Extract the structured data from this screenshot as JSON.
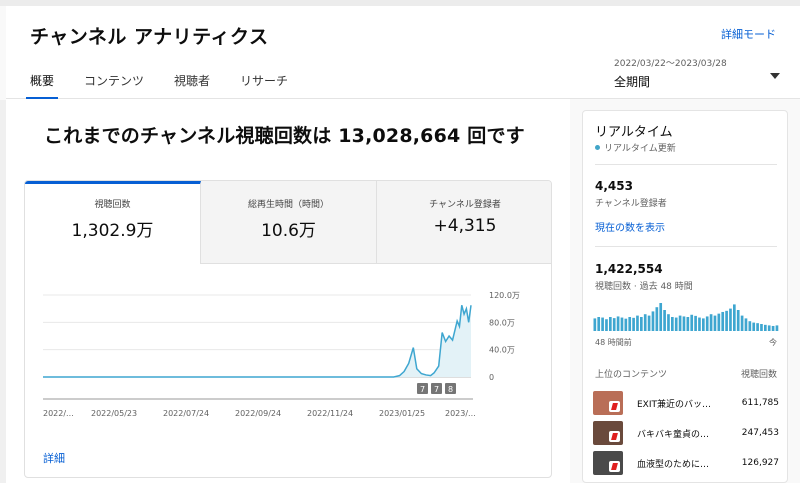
{
  "header": {
    "title": "チャンネル アナリティクス",
    "detail_mode": "詳細モード",
    "tabs": [
      "概要",
      "コンテンツ",
      "視聴者",
      "リサーチ"
    ],
    "period_range": "2022/03/22～2023/03/28",
    "period_value": "全期間"
  },
  "main": {
    "headline": "これまでのチャンネル視聴回数は 13,028,664 回です",
    "metrics": [
      {
        "label": "視聴回数",
        "value": "1,302.9万"
      },
      {
        "label": "総再生時間（時間）",
        "value": "10.6万"
      },
      {
        "label": "チャンネル登録者",
        "value": "+4,315"
      }
    ],
    "detail_link": "詳細"
  },
  "chart_data": {
    "type": "line",
    "x_ticks": [
      "2022/...",
      "2022/05/23",
      "2022/07/24",
      "2022/09/24",
      "2022/11/24",
      "2023/01/25",
      "2023/..."
    ],
    "y_ticks": [
      "120.0万",
      "80.0万",
      "40.0万",
      "0"
    ],
    "ylim": [
      0,
      1200000
    ],
    "grid": true,
    "markers": [
      "7",
      "7",
      "8"
    ],
    "x_dates": [
      "2022-03-22",
      "2022-05-23",
      "2022-07-24",
      "2022-09-24",
      "2022-11-24",
      "2023-01-10",
      "2023-01-20",
      "2023-01-25",
      "2023-01-29",
      "2023-02-02",
      "2023-02-06",
      "2023-02-09",
      "2023-02-13",
      "2023-02-17",
      "2023-02-21",
      "2023-02-24",
      "2023-02-28",
      "2023-03-03",
      "2023-03-06",
      "2023-03-09",
      "2023-03-12",
      "2023-03-14",
      "2023-03-16",
      "2023-03-18",
      "2023-03-20",
      "2023-03-22",
      "2023-03-24",
      "2023-03-26",
      "2023-03-28"
    ],
    "values": [
      0,
      0,
      0,
      0,
      0,
      0,
      0,
      20000,
      80000,
      200000,
      430000,
      120000,
      50000,
      30000,
      20000,
      60000,
      160000,
      650000,
      520000,
      600000,
      540000,
      680000,
      820000,
      740000,
      1050000,
      920000,
      1000000,
      800000,
      1050000
    ]
  },
  "realtime": {
    "title": "リアルタイム",
    "live_text": "リアルタイム更新",
    "subs_count": "4,453",
    "subs_label": "チャンネル登録者",
    "show_now": "現在の数を表示",
    "views_count": "1,422,554",
    "views_label": "視聴回数 · 過去 48 時間",
    "axis_left": "48 時間前",
    "axis_right": "今",
    "bars": [
      0.45,
      0.5,
      0.48,
      0.42,
      0.5,
      0.46,
      0.52,
      0.48,
      0.44,
      0.5,
      0.47,
      0.55,
      0.5,
      0.6,
      0.55,
      0.7,
      0.85,
      1.0,
      0.75,
      0.6,
      0.5,
      0.48,
      0.55,
      0.52,
      0.5,
      0.58,
      0.54,
      0.48,
      0.45,
      0.52,
      0.6,
      0.55,
      0.62,
      0.68,
      0.72,
      0.8,
      0.95,
      0.75,
      0.55,
      0.45,
      0.35,
      0.3,
      0.28,
      0.25,
      0.22,
      0.2,
      0.18,
      0.2
    ],
    "top_head_left": "上位のコンテンツ",
    "top_head_right": "視聴回数",
    "top_content": [
      {
        "title": "EXIT兼近のバッ…",
        "views": "611,785",
        "color": "#b96e57"
      },
      {
        "title": "バキバキ童貞の…",
        "views": "247,453",
        "color": "#6a4a3c"
      },
      {
        "title": "血液型のために…",
        "views": "126,927",
        "color": "#4a4a4a"
      }
    ]
  }
}
